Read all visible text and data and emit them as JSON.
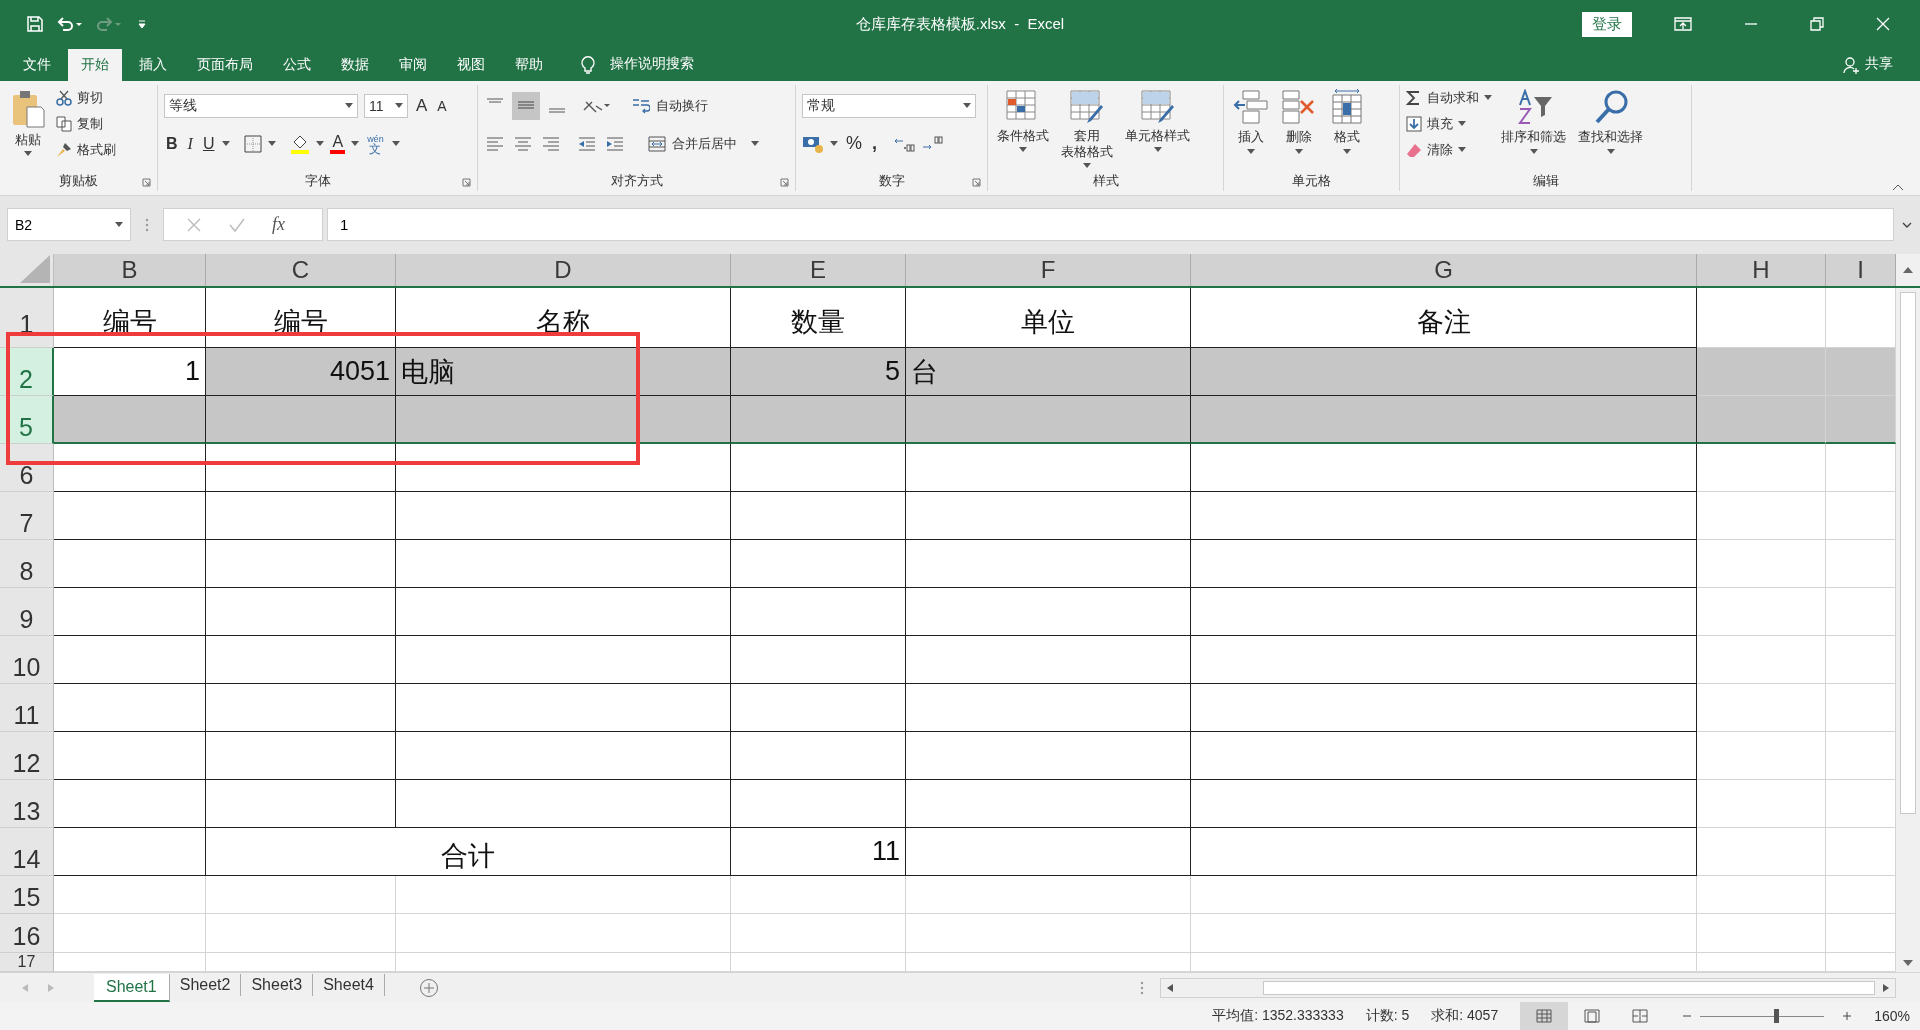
{
  "window": {
    "title": "仓库库存表格模板.xlsx  -  Excel",
    "sign_in": "登录"
  },
  "tabs": [
    {
      "label": "文件",
      "selected": false
    },
    {
      "label": "开始",
      "selected": true
    },
    {
      "label": "插入",
      "selected": false
    },
    {
      "label": "页面布局",
      "selected": false
    },
    {
      "label": "公式",
      "selected": false
    },
    {
      "label": "数据",
      "selected": false
    },
    {
      "label": "审阅",
      "selected": false
    },
    {
      "label": "视图",
      "selected": false
    },
    {
      "label": "帮助",
      "selected": false
    }
  ],
  "tell_me": "操作说明搜索",
  "share": "共享",
  "ribbon": {
    "groups": [
      {
        "kind": "clipboard",
        "label": "剪贴板",
        "paste": "粘贴",
        "items": [
          "剪切",
          "复制",
          "格式刷"
        ]
      },
      {
        "kind": "font",
        "label": "字体",
        "font_name": "等线",
        "font_size": "11",
        "grow": "A",
        "shrink": "A",
        "bold": "B",
        "italic": "I",
        "underline": "U",
        "font_color": "A",
        "phonetic_top": "wén",
        "phonetic_bottom": "文"
      },
      {
        "kind": "alignment",
        "label": "对齐方式",
        "wrap": "自动换行",
        "merge": "合并后居中"
      },
      {
        "kind": "number",
        "label": "数字",
        "format": "常规",
        "percent": "%",
        "comma": ","
      },
      {
        "kind": "styles",
        "label": "样式",
        "items": [
          [
            "条件格式"
          ],
          [
            "套用",
            "表格格式"
          ],
          [
            "单元格样式"
          ]
        ]
      },
      {
        "kind": "cells",
        "label": "单元格",
        "items": [
          "插入",
          "删除",
          "格式"
        ]
      },
      {
        "kind": "editing",
        "label": "编辑",
        "small": [
          "自动求和",
          "填充",
          "清除"
        ],
        "large": [
          "排序和筛选",
          "查找和选择"
        ]
      }
    ]
  },
  "formula_bar": {
    "name_box": "B2",
    "fx": "fx",
    "value": "1"
  },
  "columns": [
    "B",
    "C",
    "D",
    "E",
    "F",
    "G",
    "H",
    "I"
  ],
  "rows": [
    {
      "number": "1",
      "selected": false,
      "cells": [
        {
          "text": "编号",
          "kind": "header",
          "merged": false
        },
        {
          "text": "编号",
          "kind": "header",
          "merged": false
        },
        {
          "text": "名称",
          "kind": "header",
          "merged": false
        },
        {
          "text": "数量",
          "kind": "header",
          "merged": false
        },
        {
          "text": "单位",
          "kind": "header",
          "merged": false
        },
        {
          "text": "备注",
          "kind": "header",
          "merged": false
        }
      ]
    },
    {
      "number": "2",
      "selected": true,
      "cells": [
        {
          "text": "1",
          "kind": "number",
          "active": true,
          "merged": false
        },
        {
          "text": "4051",
          "kind": "number",
          "merged": false
        },
        {
          "text": "电脑",
          "kind": "text",
          "merged": false
        },
        {
          "text": "5",
          "kind": "number",
          "merged": false
        },
        {
          "text": "台",
          "kind": "text",
          "merged": false
        }
      ]
    },
    {
      "number": "5",
      "selected": true,
      "cells": []
    },
    {
      "number": "6",
      "selected": false,
      "cells": []
    },
    {
      "number": "7",
      "selected": false,
      "cells": []
    },
    {
      "number": "8",
      "selected": false,
      "cells": []
    },
    {
      "number": "9",
      "selected": false,
      "cells": []
    },
    {
      "number": "10",
      "selected": false,
      "cells": []
    },
    {
      "number": "11",
      "selected": false,
      "cells": []
    },
    {
      "number": "12",
      "selected": false,
      "cells": []
    },
    {
      "number": "13",
      "selected": false,
      "cells": []
    },
    {
      "number": "14",
      "selected": false,
      "cells": [
        null,
        {
          "text": "合计",
          "kind": "header",
          "merged": true
        },
        null,
        {
          "text": "11",
          "kind": "number",
          "merged": false
        }
      ]
    },
    {
      "number": "15",
      "selected": false,
      "cells": []
    },
    {
      "number": "16",
      "selected": false,
      "cells": []
    },
    {
      "number": "17",
      "selected": false,
      "cells": []
    }
  ],
  "sheets": [
    {
      "label": "Sheet1",
      "selected": true
    },
    {
      "label": "Sheet2",
      "selected": false
    },
    {
      "label": "Sheet3",
      "selected": false
    },
    {
      "label": "Sheet4",
      "selected": false
    }
  ],
  "status_bar": {
    "average": "平均值: 1352.333333",
    "count": "计数: 5",
    "sum": "求和: 4057",
    "zoom": {
      "level": 0.61
    },
    "zoom_text": "160%"
  }
}
